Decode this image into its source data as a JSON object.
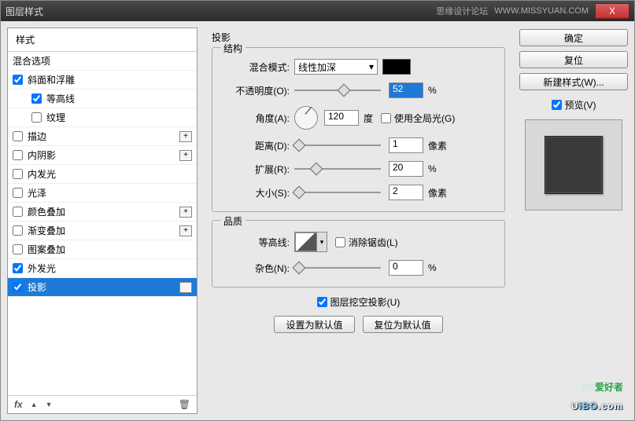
{
  "titlebar": {
    "title": "图层样式",
    "forum": "思缘设计论坛",
    "url": "WWW.MISSYUAN.COM",
    "close": "X"
  },
  "left": {
    "header": "样式",
    "items": [
      {
        "label": "混合选项",
        "checked": null,
        "plus": false,
        "indent": false
      },
      {
        "label": "斜面和浮雕",
        "checked": true,
        "plus": false,
        "indent": false
      },
      {
        "label": "等高线",
        "checked": true,
        "plus": false,
        "indent": true
      },
      {
        "label": "纹理",
        "checked": false,
        "plus": false,
        "indent": true
      },
      {
        "label": "描边",
        "checked": false,
        "plus": true,
        "indent": false
      },
      {
        "label": "内阴影",
        "checked": false,
        "plus": true,
        "indent": false
      },
      {
        "label": "内发光",
        "checked": false,
        "plus": false,
        "indent": false
      },
      {
        "label": "光泽",
        "checked": false,
        "plus": false,
        "indent": false
      },
      {
        "label": "颜色叠加",
        "checked": false,
        "plus": true,
        "indent": false
      },
      {
        "label": "渐变叠加",
        "checked": false,
        "plus": true,
        "indent": false
      },
      {
        "label": "图案叠加",
        "checked": false,
        "plus": false,
        "indent": false
      },
      {
        "label": "外发光",
        "checked": true,
        "plus": false,
        "indent": false
      },
      {
        "label": "投影",
        "checked": true,
        "plus": true,
        "indent": false,
        "selected": true
      }
    ],
    "footer": {
      "fx": "fx",
      "up": "▲",
      "down": "▼",
      "trash": "🗑"
    }
  },
  "center": {
    "section": "投影",
    "structure": {
      "legend": "结构",
      "blend_label": "混合模式:",
      "blend_value": "线性加深",
      "opacity_label": "不透明度(O):",
      "opacity_value": "52",
      "opacity_unit": "%",
      "angle_label": "角度(A):",
      "angle_value": "120",
      "angle_unit": "度",
      "global_label": "使用全局光(G)",
      "global_checked": false,
      "distance_label": "距离(D):",
      "distance_value": "1",
      "distance_unit": "像素",
      "spread_label": "扩展(R):",
      "spread_value": "20",
      "spread_unit": "%",
      "size_label": "大小(S):",
      "size_value": "2",
      "size_unit": "像素"
    },
    "quality": {
      "legend": "品质",
      "contour_label": "等高线:",
      "antialias_label": "消除锯齿(L)",
      "antialias_checked": false,
      "noise_label": "杂色(N):",
      "noise_value": "0",
      "noise_unit": "%"
    },
    "knockout": {
      "label": "图层挖空投影(U)",
      "checked": true
    },
    "buttons": {
      "default": "设置为默认值",
      "reset": "复位为默认值"
    }
  },
  "right": {
    "ok": "确定",
    "cancel": "复位",
    "newstyle": "新建样式(W)...",
    "preview_label": "预览(V)",
    "preview_checked": true
  },
  "watermark": {
    "top_pale": "PS",
    "top": "爱好者",
    "bottom_head": "U",
    "bottom_mid": "iBO",
    "bottom_tail": ".com"
  }
}
